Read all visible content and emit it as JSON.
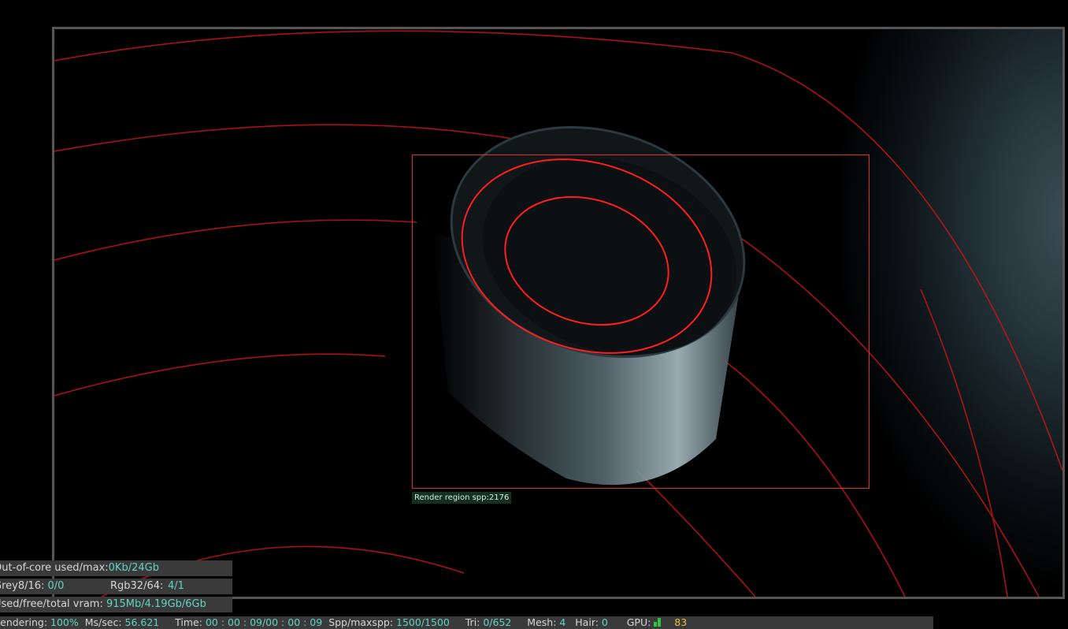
{
  "viewport": {
    "region_label": "Render region spp:2176",
    "colors": {
      "border": "#555555",
      "region_outline": "#e03030",
      "curve": "#d01818"
    }
  },
  "stats": {
    "out_of_core": {
      "label": "Out-of-core used/max:",
      "value": "0Kb/24Gb"
    },
    "grey": {
      "label": "Grey8/16: ",
      "value": "0/0"
    },
    "rgb": {
      "label": "Rgb32/64: ",
      "value": "4/1"
    },
    "vram": {
      "label": "Used/free/total vram: ",
      "value": "915Mb/4.19Gb/6Gb"
    }
  },
  "status": {
    "rendering_label": "Rendering: ",
    "rendering_value": "100%",
    "mssec_label": "Ms/sec: ",
    "mssec_value": "56.621",
    "time_label": "Time: ",
    "time_value": "00 : 00 : 09/00 : 00 : 09",
    "spp_label": "Spp/maxspp: ",
    "spp_value": "1500/1500",
    "tri_label": "Tri: ",
    "tri_value": "0/652",
    "mesh_label": "Mesh: ",
    "mesh_value": "4",
    "hair_label": "Hair: ",
    "hair_value": "0",
    "gpu_label": "GPU:",
    "gpu_temp": "83",
    "gpu_usage": 1.0
  }
}
